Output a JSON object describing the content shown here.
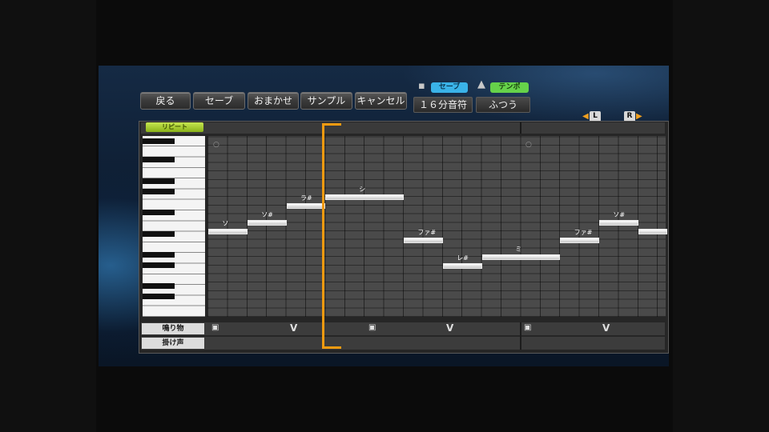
{
  "toolbar": {
    "back_label": "戻る",
    "save_label": "セーブ",
    "omakase_label": "おまかせ",
    "sample_label": "サンプル",
    "cancel_label": "キャンセル"
  },
  "settings": {
    "save_pill": "セーブ",
    "tempo_pill": "テンポ",
    "note_length": "１６分音符",
    "tempo_value": "ふつう"
  },
  "page_nav": {
    "l_label": "L",
    "r_label": "R"
  },
  "editor": {
    "repeat_label": "リピート",
    "rows": [
      {
        "label": "鳴り物"
      },
      {
        "label": "掛け声"
      }
    ],
    "notes": [
      {
        "label": "ソ",
        "beat": 0,
        "length": 2,
        "pitch_row": 10
      },
      {
        "label": "ソ#",
        "beat": 2,
        "length": 2,
        "pitch_row": 11
      },
      {
        "label": "ラ#",
        "beat": 4,
        "length": 2,
        "pitch_row": 13
      },
      {
        "label": "シ",
        "beat": 6,
        "length": 4,
        "pitch_row": 14
      },
      {
        "label": "ファ#",
        "beat": 10,
        "length": 2,
        "pitch_row": 9
      },
      {
        "label": "レ#",
        "beat": 12,
        "length": 2,
        "pitch_row": 6
      },
      {
        "label": "ミ",
        "beat": 14,
        "length": 4,
        "pitch_row": 7
      },
      {
        "label": "ファ#",
        "beat": 18,
        "length": 2,
        "pitch_row": 9
      },
      {
        "label": "ソ#",
        "beat": 20,
        "length": 2,
        "pitch_row": 11
      },
      {
        "label": "",
        "beat": 22,
        "length": 2,
        "pitch_row": 10
      }
    ]
  },
  "colors": {
    "accent_orange": "#f09a10",
    "save_blue": "#3ab3e8",
    "tempo_green": "#66d24a",
    "repeat_lime": "#a8cc30"
  },
  "icons": {
    "save_icon": "disk-icon",
    "tempo_icon": "metronome-icon",
    "percussion_icon": "drum-icon",
    "shout_icon": "v-mark-icon"
  }
}
